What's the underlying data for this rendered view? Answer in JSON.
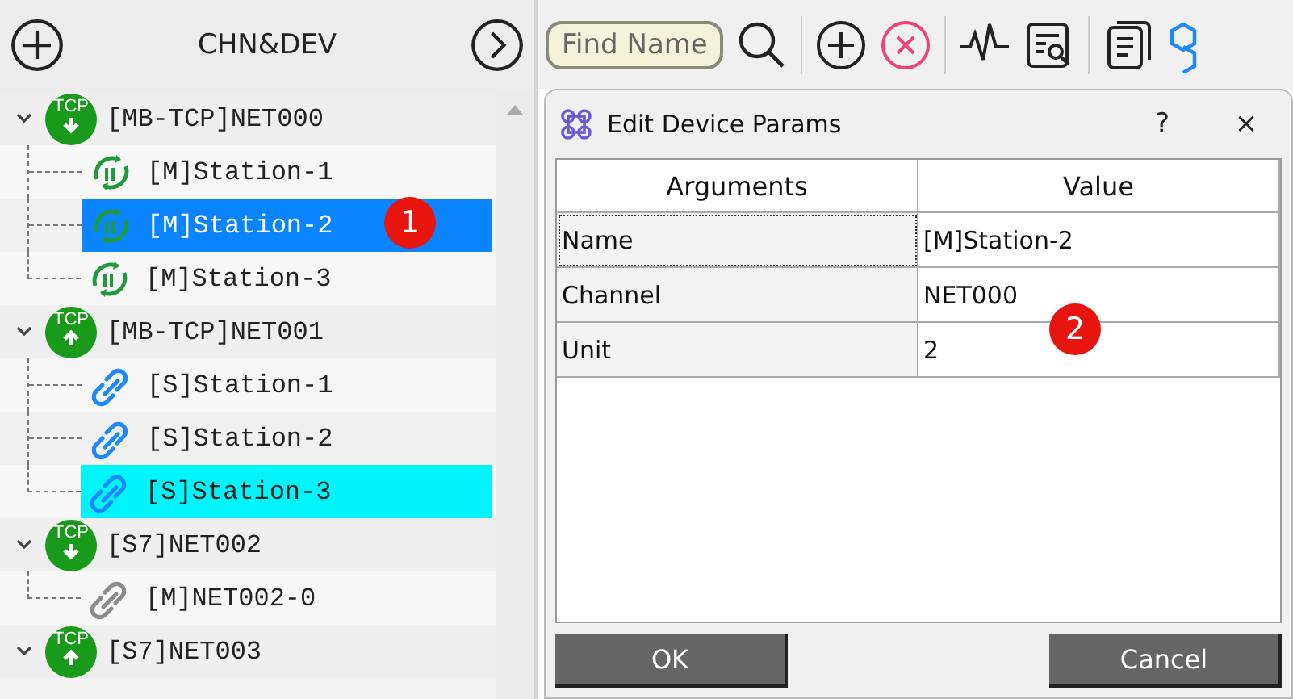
{
  "panel": {
    "title": "CHN&DEV"
  },
  "tree": [
    {
      "label": "[MB-TCP]NET000",
      "kind": "tcp-down",
      "badge": "TCP",
      "expanded": true,
      "selected": false,
      "children": [
        {
          "label": "[M]Station-1",
          "kind": "master",
          "selected": false,
          "highlighted": false
        },
        {
          "label": "[M]Station-2",
          "kind": "master",
          "selected": true,
          "highlighted": false
        },
        {
          "label": "[M]Station-3",
          "kind": "master",
          "selected": false,
          "highlighted": false
        }
      ]
    },
    {
      "label": "[MB-TCP]NET001",
      "kind": "tcp-up",
      "badge": "TCP",
      "expanded": true,
      "selected": false,
      "children": [
        {
          "label": "[S]Station-1",
          "kind": "slave",
          "selected": false,
          "highlighted": false
        },
        {
          "label": "[S]Station-2",
          "kind": "slave",
          "selected": false,
          "highlighted": false
        },
        {
          "label": "[S]Station-3",
          "kind": "slave",
          "selected": false,
          "highlighted": true
        }
      ]
    },
    {
      "label": "[S7]NET002",
      "kind": "tcp-down",
      "badge": "TCP",
      "expanded": true,
      "selected": false,
      "children": [
        {
          "label": "[M]NET002-0",
          "kind": "offline",
          "selected": false,
          "highlighted": false
        }
      ]
    },
    {
      "label": "[S7]NET003",
      "kind": "tcp-up",
      "badge": "TCP",
      "expanded": true,
      "selected": false
    }
  ],
  "toolbar": {
    "search": {
      "placeholder": "Find Name"
    }
  },
  "dialog": {
    "title": "Edit Device Params",
    "help": "?",
    "close": "×",
    "columns": [
      "Arguments",
      "Value"
    ],
    "rows": [
      {
        "argument": "Name",
        "value": "[M]Station-2",
        "focused": true
      },
      {
        "argument": "Channel",
        "value": "NET000",
        "focused": false
      },
      {
        "argument": "Unit",
        "value": "2",
        "focused": false
      }
    ],
    "buttons": [
      "OK",
      "Cancel"
    ]
  },
  "annotations": [
    {
      "label": "1"
    },
    {
      "label": "2"
    }
  ]
}
